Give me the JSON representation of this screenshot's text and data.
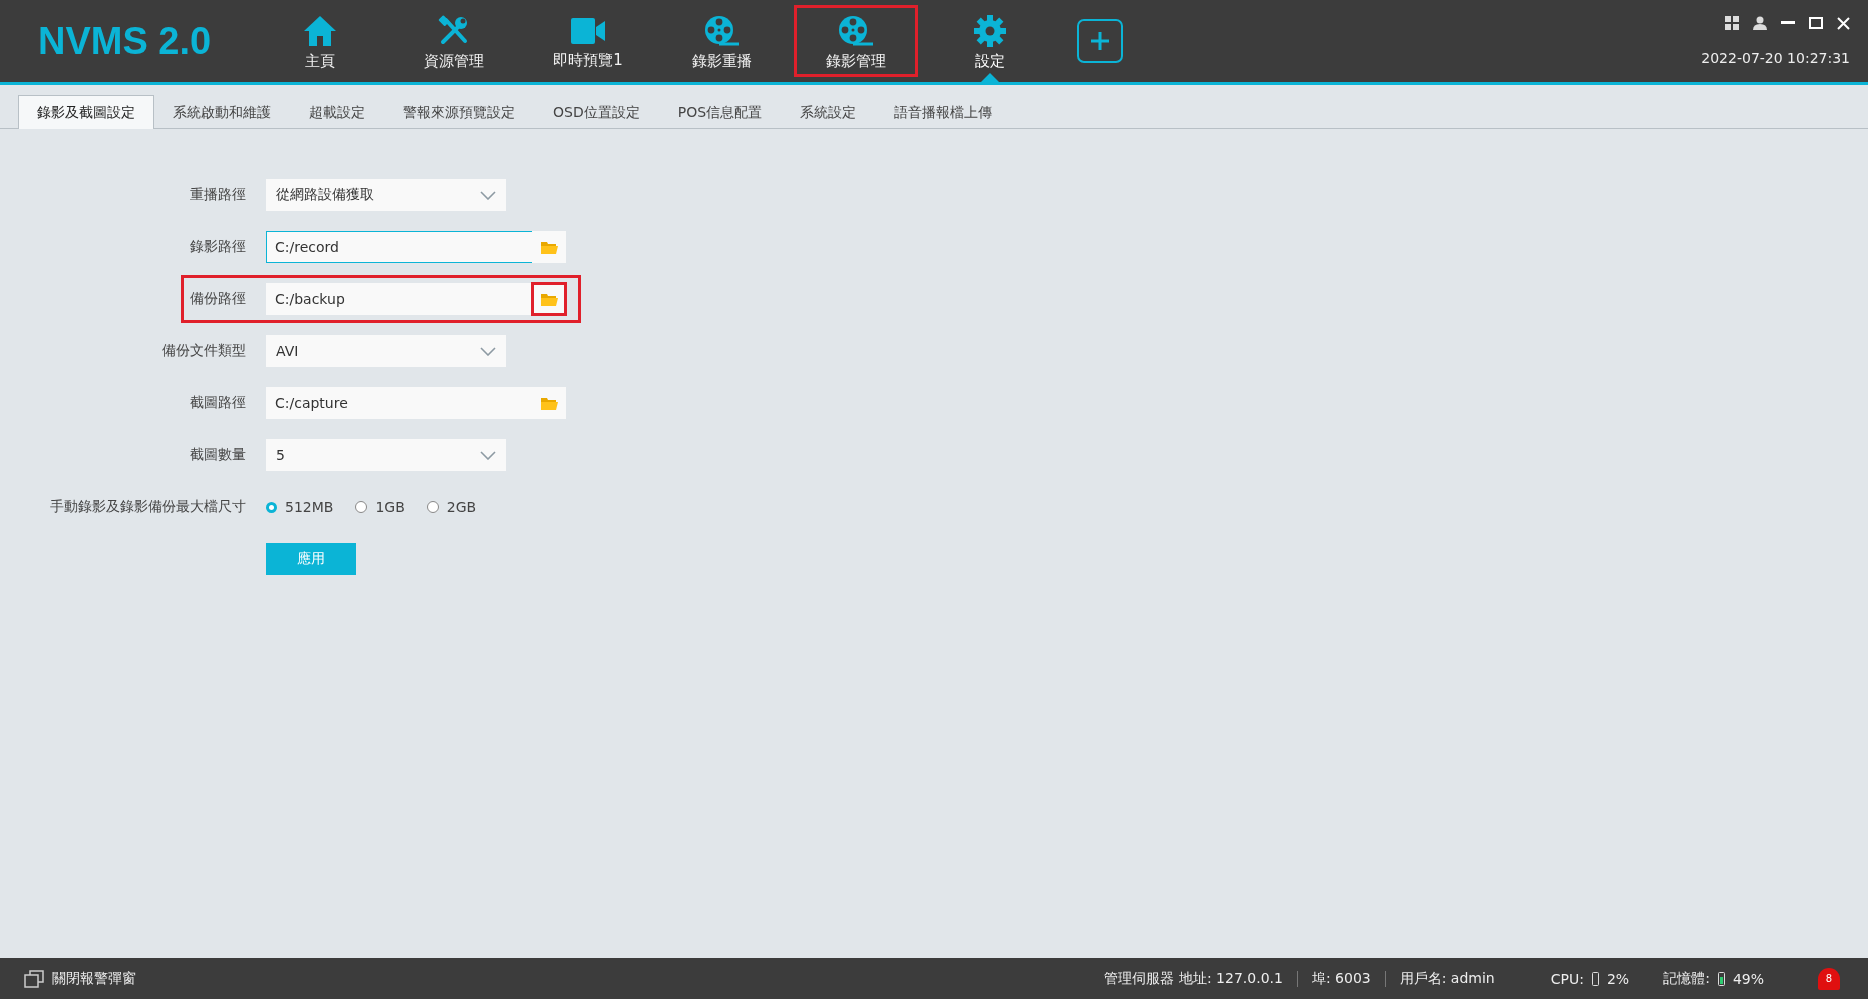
{
  "app": {
    "logo": "NVMS 2.0",
    "datetime": "2022-07-20 10:27:31"
  },
  "nav": [
    {
      "label": "主頁",
      "selected": false,
      "highlighted": false
    },
    {
      "label": "資源管理",
      "selected": false,
      "highlighted": false
    },
    {
      "label": "即時預覽1",
      "selected": false,
      "highlighted": false
    },
    {
      "label": "錄影重播",
      "selected": false,
      "highlighted": false
    },
    {
      "label": "錄影管理",
      "selected": false,
      "highlighted": true
    },
    {
      "label": "設定",
      "selected": true,
      "highlighted": false
    }
  ],
  "tabs": [
    {
      "label": "錄影及截圖設定",
      "selected": true
    },
    {
      "label": "系統啟動和維護",
      "selected": false
    },
    {
      "label": "超載設定",
      "selected": false
    },
    {
      "label": "警報來源預覽設定",
      "selected": false
    },
    {
      "label": "OSD位置設定",
      "selected": false
    },
    {
      "label": "POS信息配置",
      "selected": false
    },
    {
      "label": "系統設定",
      "selected": false
    },
    {
      "label": "語音播報檔上傳",
      "selected": false
    }
  ],
  "form": {
    "rows": [
      {
        "kind": "select",
        "label": "重播路徑",
        "value": "從網路設備獲取",
        "highlighted": false
      },
      {
        "kind": "path",
        "label": "錄影路徑",
        "value": "C:/record",
        "focused": true,
        "highlighted": false,
        "browse_highlighted": false
      },
      {
        "kind": "path",
        "label": "備份路徑",
        "value": "C:/backup",
        "focused": false,
        "highlighted": true,
        "browse_highlighted": true
      },
      {
        "kind": "select",
        "label": "備份文件類型",
        "value": "AVI",
        "highlighted": false
      },
      {
        "kind": "path",
        "label": "截圖路徑",
        "value": "C:/capture",
        "focused": false,
        "highlighted": false,
        "browse_highlighted": false
      },
      {
        "kind": "select",
        "label": "截圖數量",
        "value": "5",
        "highlighted": false
      },
      {
        "kind": "radio",
        "label": "手動錄影及錄影備份最大檔尺寸",
        "options": [
          {
            "label": "512MB",
            "selected": true
          },
          {
            "label": "1GB",
            "selected": false
          },
          {
            "label": "2GB",
            "selected": false
          }
        ]
      }
    ],
    "apply_button": "應用"
  },
  "status_bar": {
    "close_alarm_popup": "關閉報警彈窗",
    "server": "管理伺服器 地址: 127.0.0.1",
    "port": "埠: 6003",
    "user": "用戶名: admin",
    "cpu_label": "CPU:",
    "cpu": "2%",
    "memory_label": "記憶體:",
    "memory": "49%",
    "alarm_count": "8"
  }
}
